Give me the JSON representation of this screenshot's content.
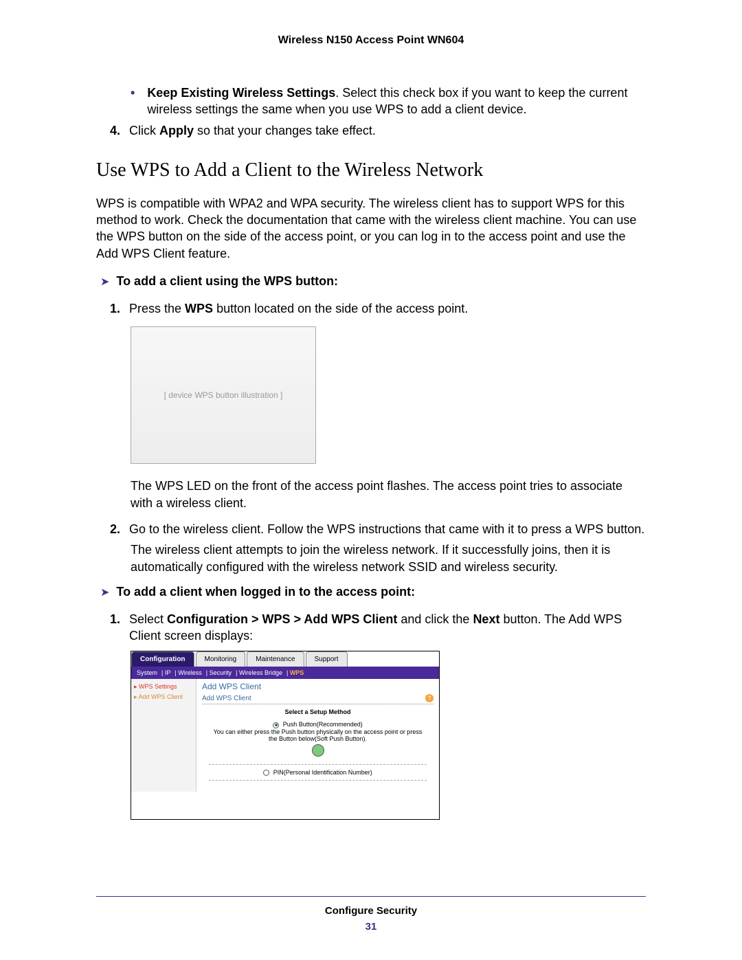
{
  "header": {
    "title": "Wireless N150 Access Point WN604"
  },
  "top_bullet": {
    "lead_bold": "Keep Existing Wireless Settings",
    "text_after": ". Select this check box if you want to keep the current wireless settings the same when you use WPS to add a client device."
  },
  "step4": {
    "num": "4.",
    "pre": "Click ",
    "bold": "Apply",
    "post": " so that your changes take effect."
  },
  "section_title": "Use WPS to Add a Client to the Wireless Network",
  "intro": "WPS is compatible with WPA2 and WPA security. The wireless client has to support WPS for this method to work. Check the documentation that came with the wireless client machine. You can use the WPS button on the side of the access point, or you can log in to the access point and use the Add WPS Client feature.",
  "proc1_title": "To add a client using the WPS button:",
  "proc1_step1": {
    "num": "1.",
    "pre": "Press the ",
    "bold": "WPS",
    "post": " button located on the side of the access point."
  },
  "proc1_after_img": "The WPS LED on the front of the access point flashes. The access point tries to associate with a wireless client.",
  "proc1_step2": {
    "num": "2.",
    "text": "Go to the wireless client. Follow the WPS instructions that came with it to press a WPS button."
  },
  "proc1_step2_after": "The wireless client attempts to join the wireless network. If it successfully joins, then it is automatically configured with the wireless network SSID and wireless security.",
  "proc2_title": "To add a client when logged in to the access point:",
  "proc2_step1": {
    "num": "1.",
    "pre": "Select ",
    "bold1": "Configuration > WPS > Add WPS Client",
    "mid": " and click the ",
    "bold2": "Next",
    "post": " button. The Add WPS Client screen displays:"
  },
  "mock": {
    "tabs": [
      "Configuration",
      "Monitoring",
      "Maintenance",
      "Support"
    ],
    "subnav": [
      "System",
      "IP",
      "Wireless",
      "Security",
      "Wireless Bridge",
      "WPS"
    ],
    "side": [
      "WPS Settings",
      "Add WPS Client"
    ],
    "h1": "Add WPS Client",
    "h2": "Add WPS Client",
    "center_title": "Select a Setup Method",
    "opt1": "Push Button(Recommended)",
    "opt1_desc": "You can either press the Push button physically on the access point or press the Button below(Soft Push Button).",
    "opt2": "PIN(Personal Identification Number)"
  },
  "footer": {
    "title": "Configure Security",
    "page": "31"
  }
}
